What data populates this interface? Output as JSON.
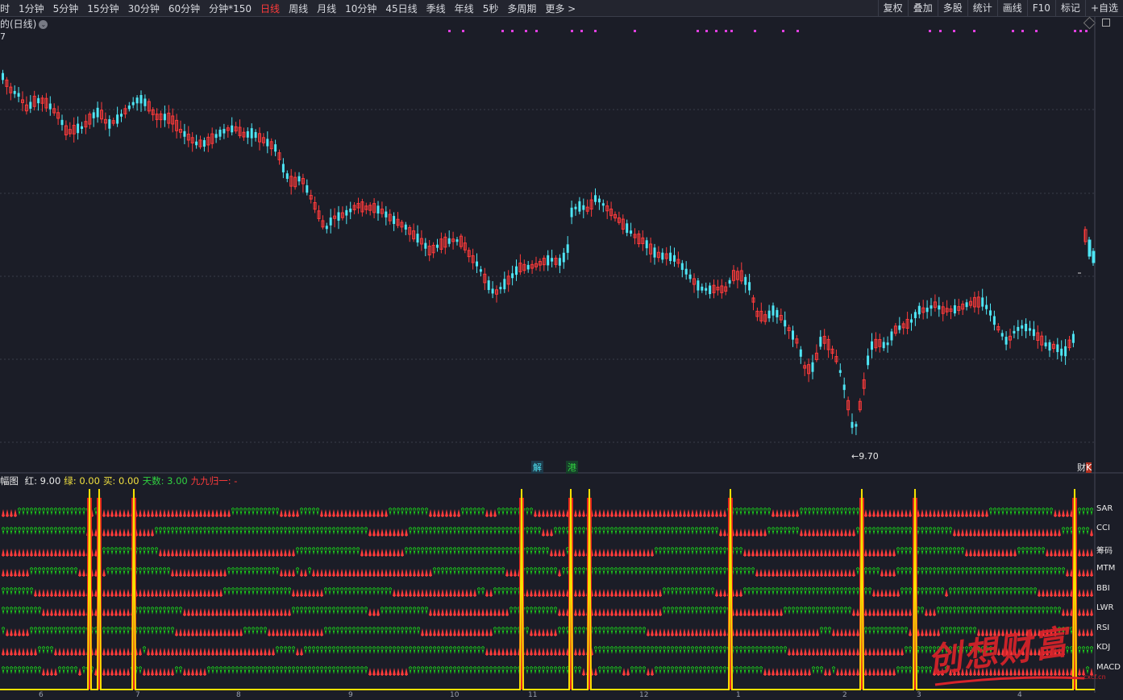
{
  "toolbar": {
    "periods": [
      "时",
      "1分钟",
      "5分钟",
      "15分钟",
      "30分钟",
      "60分钟",
      "分钟*150",
      "日线",
      "周线",
      "月线",
      "10分钟",
      "45日线",
      "季线",
      "年线",
      "5秒",
      "多周期",
      "更多 >"
    ],
    "active": "日线",
    "right": [
      "复权",
      "叠加",
      "多股",
      "统计",
      "画线",
      "F10",
      "标记",
      "+自选"
    ]
  },
  "chart_title": "的(日线)",
  "price_top": "7",
  "low_label": "←9.70",
  "tags": {
    "jie": "解",
    "gang": "港",
    "cai": "财",
    "k": "K"
  },
  "indicator": {
    "name": "幅图",
    "items": [
      {
        "label": "红: 9.00",
        "color": "#e8e8e8"
      },
      {
        "label": "绿: 0.00",
        "color": "#f0e040"
      },
      {
        "label": "买: 0.00",
        "color": "#f0e040"
      },
      {
        "label": "天数: 3.00",
        "color": "#30d040"
      },
      {
        "label": "九九归一: -",
        "color": "#ff3b3b"
      }
    ],
    "rows": [
      "SAR",
      "CCI",
      "筹码",
      "MTM",
      "BBI",
      "LWR",
      "RSI",
      "KDJ",
      "MACD"
    ]
  },
  "x_labels": [
    "6",
    "7",
    "8",
    "9",
    "10",
    "11",
    "12",
    "1",
    "2",
    "3",
    "4"
  ],
  "watermark": {
    "text": "创想财富",
    "url": "cxcf.cn"
  },
  "colors": {
    "up": "#ff3b3b",
    "down": "#4ee6f5",
    "green": "#1bd31b",
    "yellow": "#f5e100",
    "magenta": "#e040e0"
  }
}
